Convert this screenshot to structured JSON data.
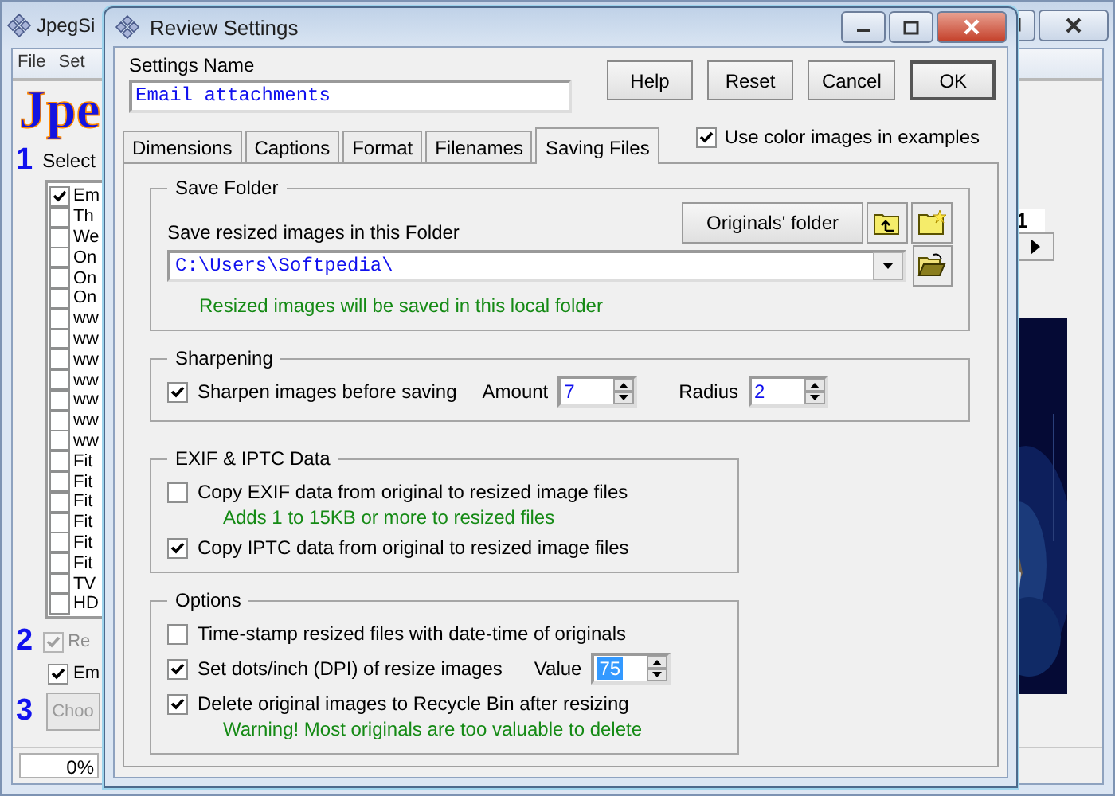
{
  "main_window": {
    "title": "JpegSi",
    "menu": [
      "File",
      "Set"
    ],
    "logo": "Jpe",
    "step1_number": "1",
    "step1_label": "Select",
    "files": [
      {
        "label": "Em",
        "checked": true
      },
      {
        "label": "Th",
        "checked": false
      },
      {
        "label": "We",
        "checked": false
      },
      {
        "label": "On",
        "checked": false
      },
      {
        "label": "On",
        "checked": false
      },
      {
        "label": "On",
        "checked": false
      },
      {
        "label": "ww",
        "checked": false
      },
      {
        "label": "ww",
        "checked": false
      },
      {
        "label": "ww",
        "checked": false
      },
      {
        "label": "ww",
        "checked": false
      },
      {
        "label": "ww",
        "checked": false
      },
      {
        "label": "ww",
        "checked": false
      },
      {
        "label": "ww",
        "checked": false
      },
      {
        "label": "Fit",
        "checked": false
      },
      {
        "label": "Fit",
        "checked": false
      },
      {
        "label": "Fit",
        "checked": false
      },
      {
        "label": "Fit",
        "checked": false
      },
      {
        "label": "Fit",
        "checked": false
      },
      {
        "label": "Fit",
        "checked": false
      },
      {
        "label": "TV",
        "checked": false
      },
      {
        "label": "HD",
        "checked": false
      }
    ],
    "step2_number": "2",
    "step2_options": [
      {
        "label": "Re",
        "checked": true,
        "disabled": true
      },
      {
        "label": "Em",
        "checked": true,
        "disabled": false
      }
    ],
    "step3_number": "3",
    "choose_button": {
      "label": "Choo",
      "disabled": true
    },
    "progress": "0%",
    "page_number": "1"
  },
  "dialog": {
    "title": "Review Settings",
    "name_label": "Settings Name",
    "name_value": "Email attachments",
    "buttons": [
      {
        "label": "Help",
        "default": false
      },
      {
        "label": "Reset",
        "default": false
      },
      {
        "label": "Cancel",
        "default": false
      },
      {
        "label": "OK",
        "default": true
      }
    ],
    "tabs": [
      {
        "label": "Dimensions",
        "selected": false
      },
      {
        "label": "Captions",
        "selected": false
      },
      {
        "label": "Format",
        "selected": false
      },
      {
        "label": "Filenames",
        "selected": false
      },
      {
        "label": "Saving Files",
        "selected": true
      }
    ],
    "color_examples": {
      "label": "Use color images in examples",
      "checked": true
    },
    "save_folder": {
      "title": "Save Folder",
      "originals_button": "Originals' folder",
      "label": "Save resized images in this Folder",
      "path": "C:\\Users\\Softpedia\\",
      "note": "Resized images will be saved in this local folder"
    },
    "sharpening": {
      "title": "Sharpening",
      "label": "Sharpen images before saving",
      "checked": true,
      "amount_label": "Amount",
      "amount": "7",
      "radius_label": "Radius",
      "radius": "2"
    },
    "exif_iptc": {
      "title": "EXIF & IPTC Data",
      "options": [
        {
          "label": "Copy EXIF data from original to resized image files",
          "checked": false,
          "note": "Adds 1 to 15KB or more to resized files"
        },
        {
          "label": "Copy IPTC data from original to resized image files",
          "checked": true
        }
      ]
    },
    "options": {
      "title": "Options",
      "items": [
        {
          "label": "Time-stamp resized files with date-time of originals",
          "checked": false
        },
        {
          "label": "Set dots/inch (DPI) of resize images",
          "checked": true,
          "value_label": "Value",
          "value": "75",
          "value_selected": true
        },
        {
          "label": "Delete original images to Recycle Bin after resizing",
          "checked": true,
          "note": "Warning! Most originals are too valuable to delete"
        }
      ]
    }
  }
}
